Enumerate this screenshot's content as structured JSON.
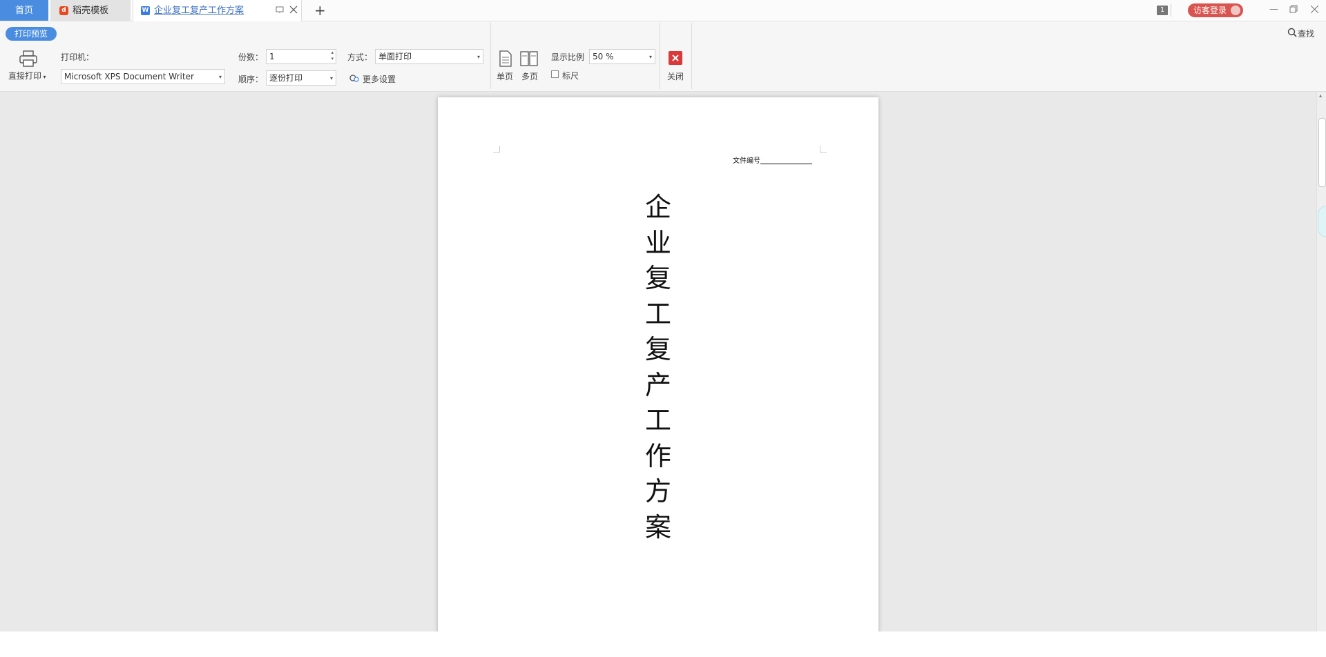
{
  "tabs": [
    {
      "label": "首页"
    },
    {
      "label": "稻壳模板"
    },
    {
      "label": "企业复工复产工作方案"
    }
  ],
  "tabbar": {
    "new_tab": "+",
    "window_count": "1",
    "login_label": "访客登录"
  },
  "toolbar": {
    "mode_badge": "打印预览",
    "direct_print": "直接打印",
    "printer_label": "打印机：",
    "printer_value": "Microsoft XPS Document Writer",
    "copies_label": "份数：",
    "copies_value": "1",
    "order_label": "顺序：",
    "order_value": "逐份打印",
    "method_label": "方式：",
    "method_value": "单面打印",
    "more_settings": "更多设置",
    "single_page": "单页",
    "multi_page": "多页",
    "zoom_label": "显示比例",
    "zoom_value": "50 %",
    "ruler_label": "标尺",
    "close_label": "关闭",
    "search_label": "查找"
  },
  "document": {
    "file_no_label": "文件编号",
    "title_chars": [
      "企",
      "业",
      "复",
      "工",
      "复",
      "产",
      "工",
      "作",
      "方",
      "案"
    ]
  }
}
